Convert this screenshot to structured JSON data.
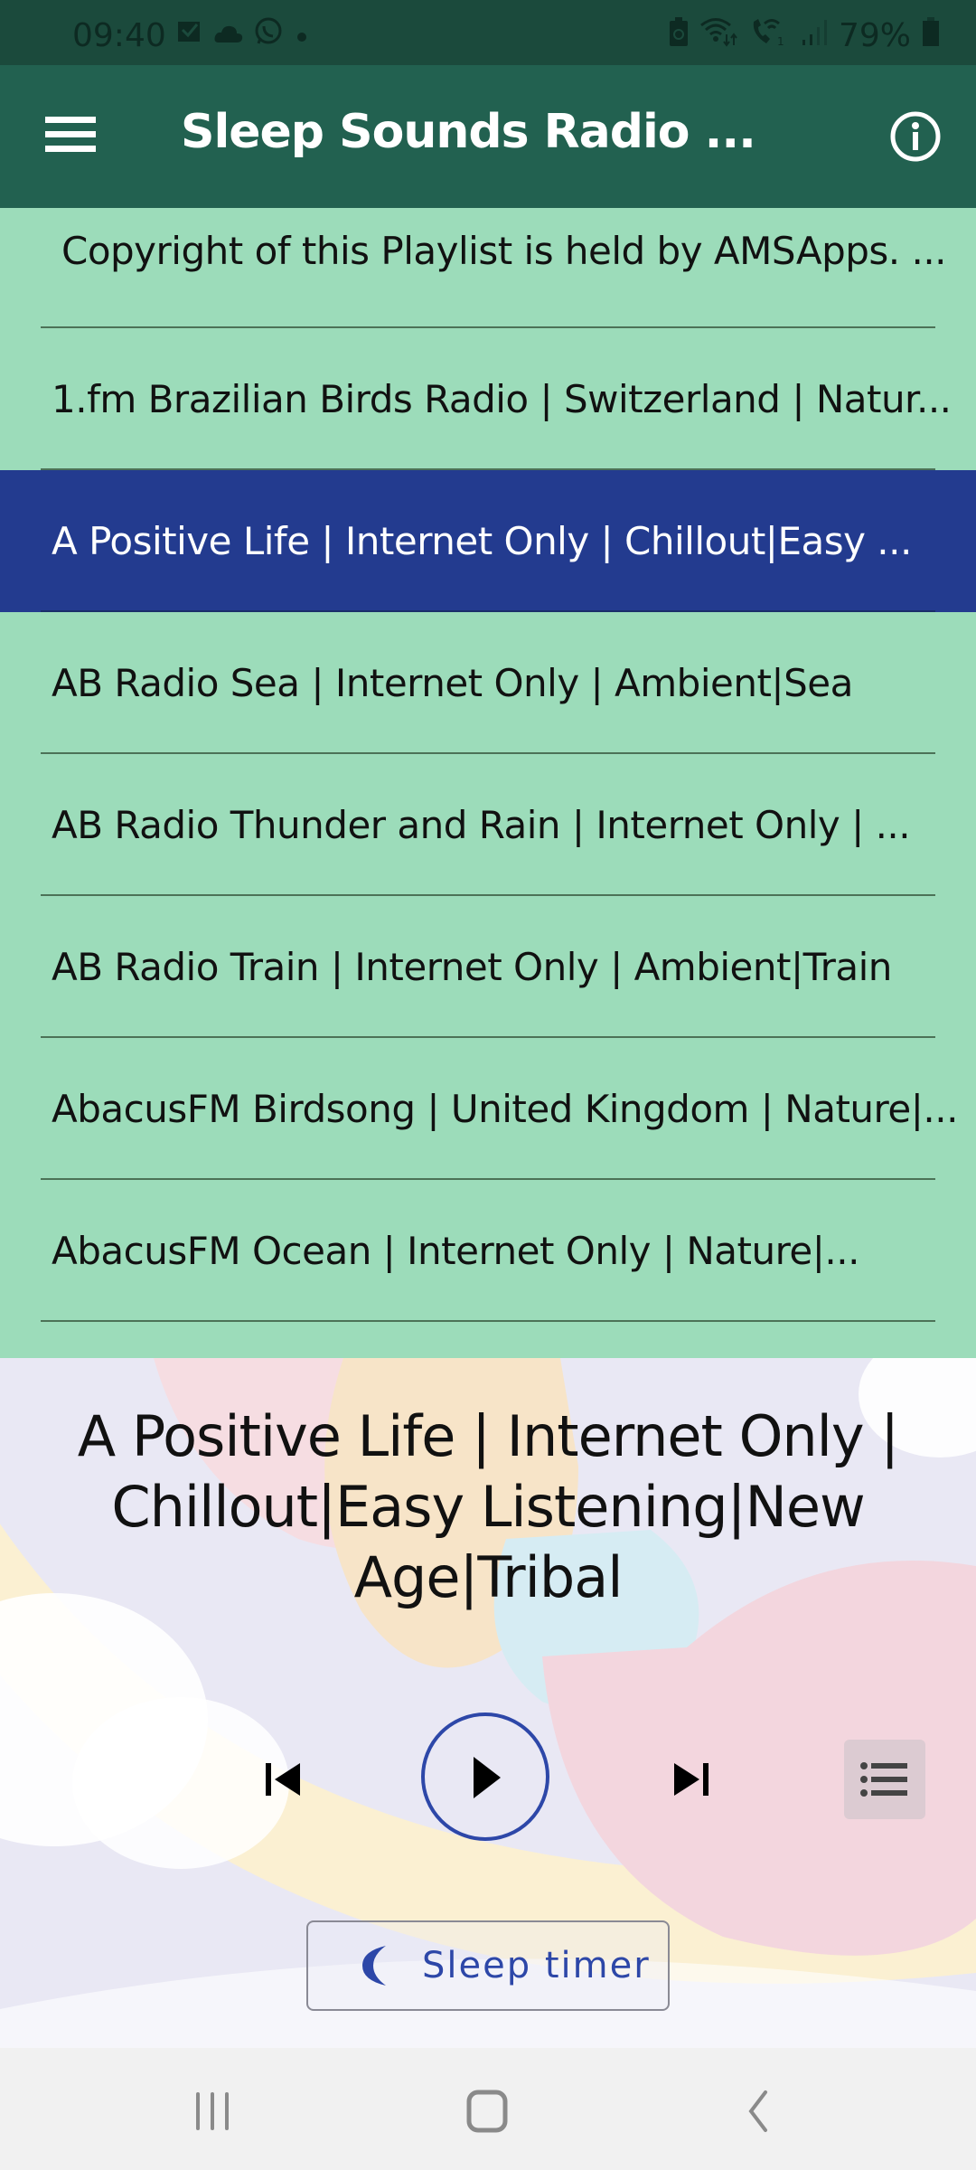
{
  "status_bar": {
    "time": "09:40",
    "left_icons": [
      "email-icon",
      "cloud-icon",
      "whatsapp-icon",
      "dot-icon"
    ],
    "right_icons": [
      "battery-saver-icon",
      "wifi-icon",
      "wifi-calling-icon",
      "signal-icon"
    ],
    "battery": "79%"
  },
  "app_bar": {
    "title": "Sleep Sounds Radio ...",
    "menu_icon": "hamburger-menu-icon",
    "info_icon": "info-icon"
  },
  "playlist": {
    "items": [
      {
        "label": "Copyright of this Playlist is held by AMSApps. ...",
        "selected": false
      },
      {
        "label": "1.fm Brazilian Birds Radio | Switzerland | Natur...",
        "selected": false
      },
      {
        "label": "A Positive Life | Internet Only | Chillout|Easy ...",
        "selected": true
      },
      {
        "label": "AB Radio Sea | Internet Only | Ambient|Sea",
        "selected": false
      },
      {
        "label": "AB Radio Thunder and Rain | Internet Only | ...",
        "selected": false
      },
      {
        "label": "AB Radio Train | Internet Only | Ambient|Train",
        "selected": false
      },
      {
        "label": "AbacusFM Birdsong | United Kingdom | Nature|...",
        "selected": false
      },
      {
        "label": "AbacusFM Ocean | Internet Only | Nature|...",
        "selected": false
      }
    ]
  },
  "player": {
    "now_playing": "A Positive Life | Internet Only | Chillout|Easy Listening|New Age|Tribal",
    "controls": [
      "skip-previous-icon",
      "play-icon",
      "skip-next-icon",
      "playlist-icon"
    ],
    "sleep_timer_label": "Sleep timer"
  },
  "colors": {
    "status_bar": "#1b4a3c",
    "app_bar": "#226150",
    "list_bg": "#9cdcba",
    "selected_row": "#233b8f",
    "accent": "#2d47a8"
  },
  "nav_bar": {
    "buttons": [
      "recent-apps-icon",
      "home-icon",
      "back-icon"
    ]
  }
}
